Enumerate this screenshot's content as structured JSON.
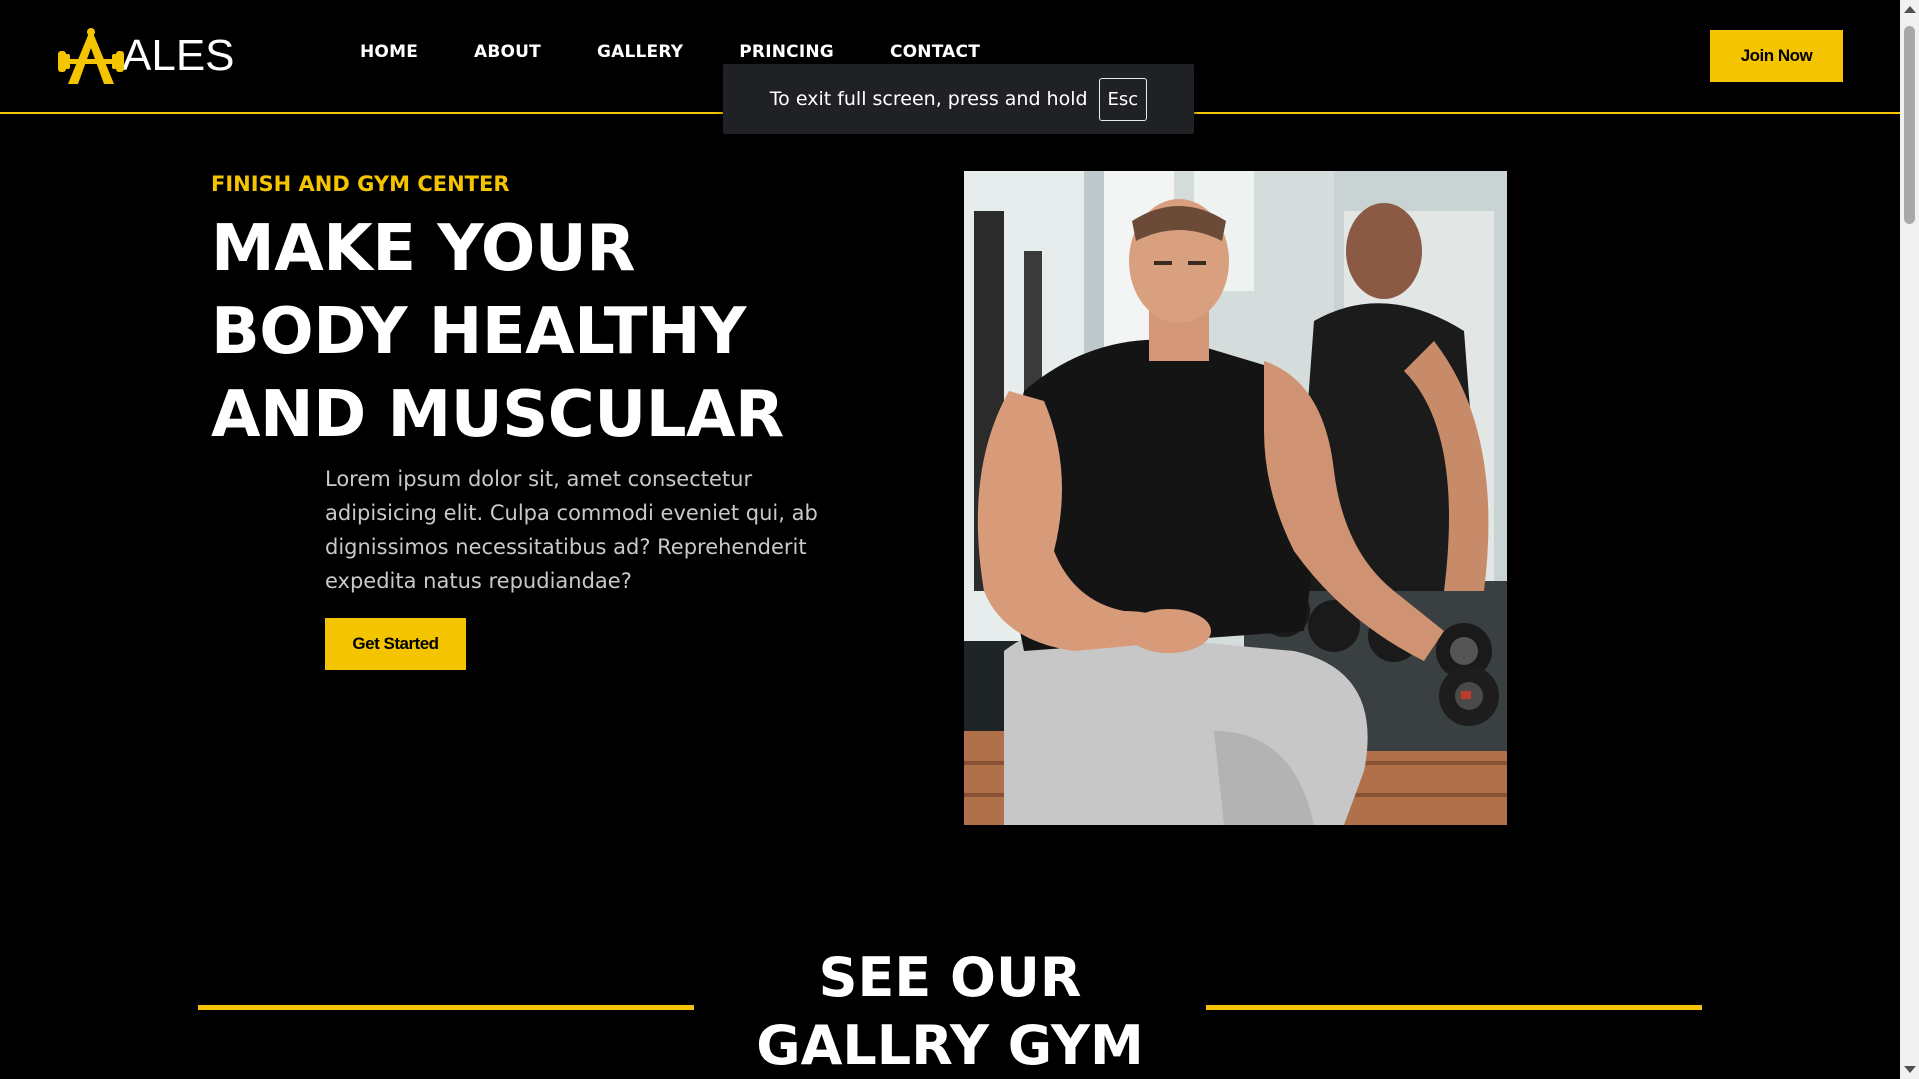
{
  "header": {
    "logo_text": "ALES",
    "nav": [
      "HOME",
      "ABOUT",
      "GALLERY",
      "PRINCING",
      "CONTACT"
    ],
    "join_label": "Join Now"
  },
  "fullscreen_toast": {
    "message": "To exit full screen, press and hold",
    "key": "Esc"
  },
  "hero": {
    "kicker": "FINISH AND GYM CENTER",
    "title_lines": [
      "MAKE YOUR",
      "BODY HEALTHY",
      "AND MUSCULAR"
    ],
    "description": "Lorem ipsum dolor sit, amet consectetur adipisicing elit. Culpa commodi eveniet qui, ab dignissimos necessitatibus ad? Reprehenderit expedita natus repudiandae?",
    "cta_label": "Get Started"
  },
  "gallery": {
    "title_lines": [
      "SEE OUR",
      "GALLRY GYM"
    ]
  },
  "colors": {
    "accent": "#f5c400",
    "background": "#000000",
    "text": "#ffffff"
  }
}
